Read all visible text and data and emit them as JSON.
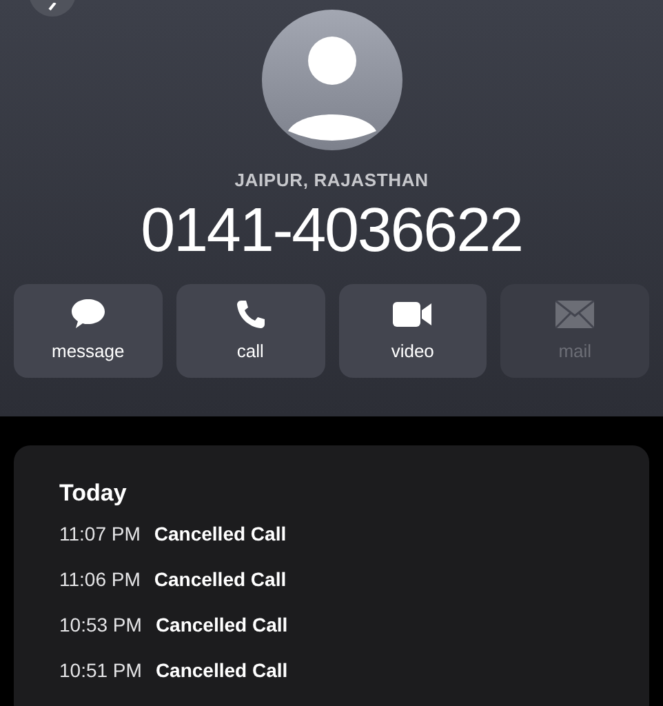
{
  "contact": {
    "location": "JAIPUR, RAJASTHAN",
    "number": "0141-4036622"
  },
  "actions": [
    {
      "kind": "message",
      "label": "message",
      "disabled": false
    },
    {
      "kind": "call",
      "label": "call",
      "disabled": false
    },
    {
      "kind": "video",
      "label": "video",
      "disabled": false
    },
    {
      "kind": "mail",
      "label": "mail",
      "disabled": true
    }
  ],
  "history": {
    "heading": "Today",
    "entries": [
      {
        "time": "11:07 PM",
        "status": "Cancelled Call"
      },
      {
        "time": "11:06 PM",
        "status": "Cancelled Call"
      },
      {
        "time": "10:53 PM",
        "status": "Cancelled Call"
      },
      {
        "time": "10:51 PM",
        "status": "Cancelled Call"
      }
    ]
  }
}
